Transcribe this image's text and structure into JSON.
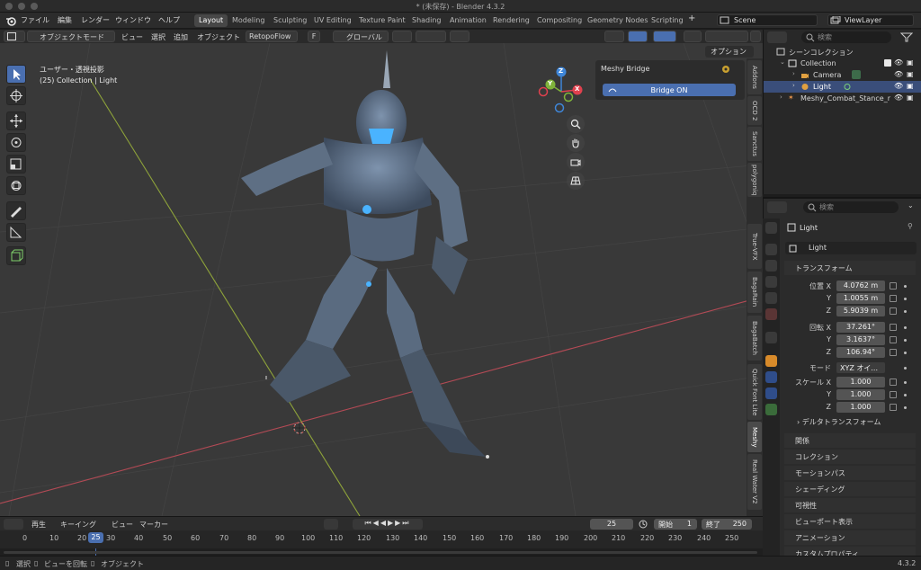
{
  "window": {
    "title": "* (未保存) - Blender 4.3.2"
  },
  "menu": {
    "items": [
      "ファイル",
      "編集",
      "レンダー",
      "ウィンドウ",
      "ヘルプ"
    ]
  },
  "workspaces": {
    "tabs": [
      "Layout",
      "Modeling",
      "Sculpting",
      "UV Editing",
      "Texture Paint",
      "Shading",
      "Animation",
      "Rendering",
      "Compositing",
      "Geometry Nodes",
      "Scripting"
    ],
    "active": "Layout",
    "add_symbol": "+"
  },
  "scene": {
    "label": "Scene",
    "viewlayer": "ViewLayer"
  },
  "viewport_header": {
    "mode": "オブジェクトモード",
    "menus": [
      "ビュー",
      "選択",
      "追加",
      "オブジェクト"
    ],
    "addon_label": "RetopoFlow",
    "addon_key": "F",
    "orientation": "グローバル",
    "options_label": "オプション"
  },
  "viewport": {
    "overlay_line1": "ユーザー・透視投影",
    "overlay_line2": "(25) Collection | Light"
  },
  "gizmo": {
    "x": "X",
    "y": "Y",
    "z": "Z"
  },
  "npanel": {
    "title": "Meshy Bridge",
    "button": "Bridge ON"
  },
  "side_tabs": [
    "Addons",
    "OCD 2",
    "Sanctus",
    "polygoniq",
    "True-VFX",
    "BagaRain",
    "BagaBatch",
    "Quick Font Lite",
    "Meshy",
    "Real Water V2"
  ],
  "side_tab_active": "Meshy",
  "outliner": {
    "search_placeholder": "検索",
    "rows": [
      {
        "label": "シーンコレクション"
      },
      {
        "label": "Collection"
      },
      {
        "label": "Camera"
      },
      {
        "label": "Light"
      },
      {
        "label": "Meshy_Combat_Stance_r"
      }
    ]
  },
  "properties": {
    "search_placeholder": "検索",
    "object_name": "Light",
    "datablock_name": "Light",
    "transform_section": "トランスフォーム",
    "location_label": "位置 X",
    "location": [
      "4.0762 m",
      "1.0055 m",
      "5.9039 m"
    ],
    "rotation_label": "回転 X",
    "rotation": [
      "37.261°",
      "3.1637°",
      "106.94°"
    ],
    "axis_y": "Y",
    "axis_z": "Z",
    "mode_label": "モード",
    "mode_value": "XYZ オイ...",
    "scale_label": "スケール X",
    "scale": [
      "1.000",
      "1.000",
      "1.000"
    ],
    "delta_section": "デルタトランスフォーム",
    "sections": [
      "関係",
      "コレクション",
      "モーションパス",
      "シェーディング",
      "可視性",
      "ビューポート表示",
      "アニメーション",
      "カスタムプロパティ"
    ]
  },
  "timeline": {
    "playback": "再生",
    "keying": "キーイング",
    "view": "ビュー",
    "marker": "マーカー",
    "current_frame": "25",
    "start_label": "開始",
    "start": "1",
    "end_label": "終了",
    "end": "250",
    "ticks": [
      "0",
      "10",
      "20",
      "25",
      "30",
      "40",
      "50",
      "60",
      "70",
      "80",
      "90",
      "100",
      "110",
      "120",
      "130",
      "140",
      "150",
      "160",
      "170",
      "180",
      "190",
      "200",
      "210",
      "220",
      "230",
      "240",
      "250"
    ]
  },
  "statusbar": {
    "select": "選択",
    "rotate": "ビューを回転",
    "object": "オブジェクト",
    "version": "4.3.2"
  },
  "colors": {
    "accent": "#4a6fb0",
    "selected_row": "#3a4e7a",
    "gizmo_x": "#e0414e",
    "gizmo_y": "#7fb33a",
    "gizmo_z": "#3f86d8"
  }
}
